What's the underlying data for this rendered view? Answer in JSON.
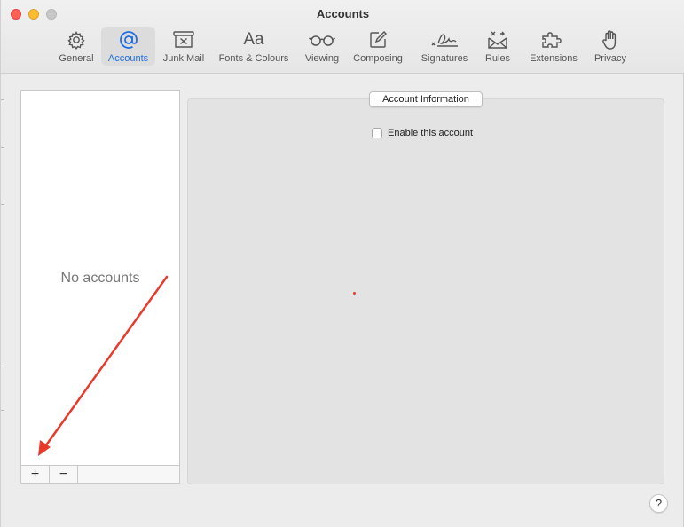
{
  "window": {
    "title": "Accounts",
    "controls": [
      "close",
      "minimize",
      "zoom"
    ]
  },
  "toolbar": {
    "tabs": [
      {
        "id": "general",
        "label": "General",
        "icon": "gear-icon"
      },
      {
        "id": "accounts",
        "label": "Accounts",
        "icon": "at-sign-icon",
        "active": true
      },
      {
        "id": "junk",
        "label": "Junk Mail",
        "icon": "junk-bin-icon"
      },
      {
        "id": "fonts",
        "label": "Fonts & Colours",
        "icon": "font-aa-icon"
      },
      {
        "id": "viewing",
        "label": "Viewing",
        "icon": "glasses-icon"
      },
      {
        "id": "composing",
        "label": "Composing",
        "icon": "compose-pencil-icon"
      },
      {
        "id": "signatures",
        "label": "Signatures",
        "icon": "signature-icon"
      },
      {
        "id": "rules",
        "label": "Rules",
        "icon": "envelope-rules-icon"
      },
      {
        "id": "extensions",
        "label": "Extensions",
        "icon": "puzzle-piece-icon"
      },
      {
        "id": "privacy",
        "label": "Privacy",
        "icon": "hand-icon"
      }
    ]
  },
  "accounts_list": {
    "empty_text": "No accounts",
    "add_label": "+",
    "remove_label": "−"
  },
  "account_info": {
    "section_title": "Account Information",
    "enable_label": "Enable this account",
    "enabled": false
  },
  "help": {
    "label": "?"
  },
  "annotation": {
    "arrow_color": "#e83a2a"
  }
}
